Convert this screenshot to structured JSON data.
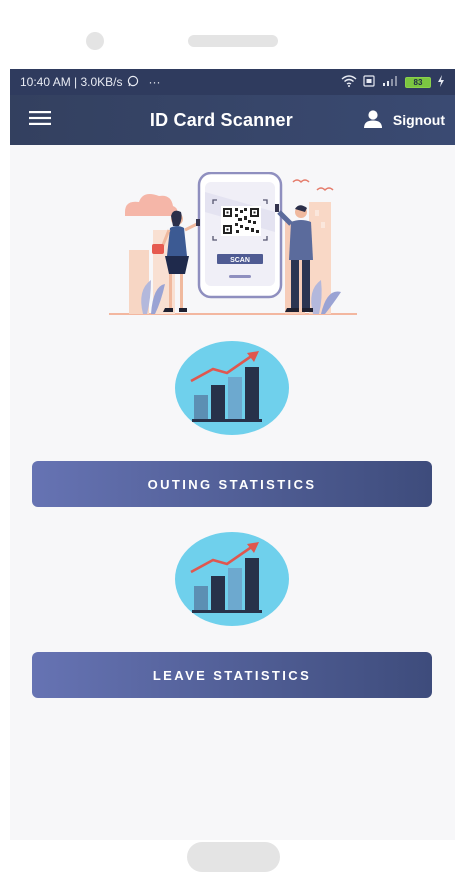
{
  "status_bar": {
    "time_and_speed": "10:40 AM | 3.0KB/s",
    "dots": "···",
    "battery": "83"
  },
  "app_bar": {
    "title": "ID Card Scanner",
    "menu_icon": "hamburger-menu-icon",
    "user_icon": "user-icon",
    "signout_label": "Signout"
  },
  "hero": {
    "scan_label": "SCAN"
  },
  "actions": [
    {
      "icon": "bar-chart-icon",
      "label": "OUTING STATISTICS"
    },
    {
      "icon": "bar-chart-icon",
      "label": "LEAVE STATISTICS"
    }
  ],
  "colors": {
    "header": "#33405f",
    "button_start": "#6673b3",
    "button_end": "#3e4c7c",
    "chart_circle": "#6fd0ec",
    "chart_arrow": "#e0574f"
  }
}
